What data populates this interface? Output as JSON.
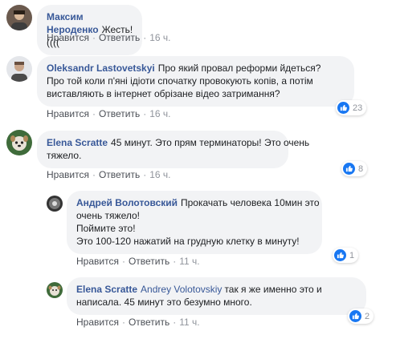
{
  "colors": {
    "author": "#385898",
    "bubble": "#f2f3f5",
    "like": "#1877f2"
  },
  "comments": [
    {
      "author": "Максим Нероденко",
      "lines": [
        "Жесть!(((("
      ],
      "actions": {
        "like": "Нравится",
        "reply": "Ответить",
        "time": "16 ч."
      },
      "reactions": null
    },
    {
      "author": "Oleksandr Lastovetskyi",
      "lines": [
        "Про який провал реформи йдеться?",
        "Про той коли п'яні ідіоти спочатку провокують копів, а потім",
        "виставляють в інтернет обрізане відео затримання?"
      ],
      "actions": {
        "like": "Нравится",
        "reply": "Ответить",
        "time": "16 ч."
      },
      "reactions": "23"
    },
    {
      "author": "Elena Scratte",
      "lines": [
        "45 минут. Это прям терминаторы! Это очень",
        "тяжело."
      ],
      "actions": {
        "like": "Нравится",
        "reply": "Ответить",
        "time": "16 ч."
      },
      "reactions": "8"
    },
    {
      "author": "Андрей Волотовский",
      "lines": [
        "Прокачать человека 10мин это",
        "очень тяжело!",
        "Поймите это!",
        "Это 100-120 нажатий на грудную клетку в минуту!"
      ],
      "actions": {
        "like": "Нравится",
        "reply": "Ответить",
        "time": "11 ч."
      },
      "reactions": "1"
    },
    {
      "author": "Elena Scratte",
      "mention": "Andrey Volotovskiy",
      "lines": [
        "так я же именно это и",
        "написала. 45 минут это безумно много."
      ],
      "actions": {
        "like": "Нравится",
        "reply": "Ответить",
        "time": "11 ч."
      },
      "reactions": "2"
    }
  ]
}
